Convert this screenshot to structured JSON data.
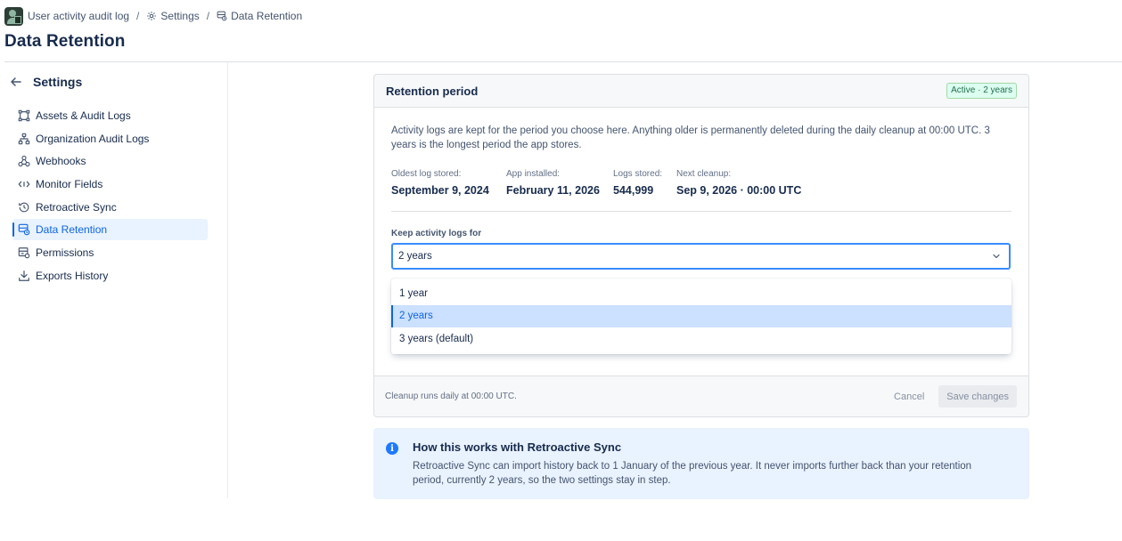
{
  "breadcrumb": {
    "app": "User activity audit log",
    "settings": "Settings",
    "current": "Data Retention"
  },
  "page_title": "Data Retention",
  "sidebar": {
    "title": "Settings",
    "items": [
      {
        "label": "Assets & Audit Logs",
        "icon": "assets-icon"
      },
      {
        "label": "Organization Audit Logs",
        "icon": "org-tree-icon"
      },
      {
        "label": "Webhooks",
        "icon": "webhook-icon"
      },
      {
        "label": "Monitor Fields",
        "icon": "code-icon"
      },
      {
        "label": "Retroactive Sync",
        "icon": "history-icon"
      },
      {
        "label": "Data Retention",
        "icon": "data-retention-icon",
        "active": true
      },
      {
        "label": "Permissions",
        "icon": "permissions-icon"
      },
      {
        "label": "Exports History",
        "icon": "download-icon"
      }
    ]
  },
  "retention": {
    "title": "Retention period",
    "badge": "Active · 2 years",
    "description": "Activity logs are kept for the period you choose here. Anything older is permanently deleted during the daily cleanup at 00:00 UTC. 3 years is the longest period the app stores.",
    "stats": [
      {
        "label": "Oldest log stored:",
        "value": "September 9, 2024"
      },
      {
        "label": "App installed:",
        "value": "February 11, 2026"
      },
      {
        "label": "Logs stored:",
        "value": "544,999"
      },
      {
        "label": "Next cleanup:",
        "value": "Sep 9, 2026 · 00:00 UTC"
      }
    ],
    "field_label": "Keep activity logs for",
    "selected": "2 years",
    "options": [
      "1 year",
      "2 years",
      "3 years (default)"
    ],
    "footer_note": "Cleanup runs daily at 00:00 UTC.",
    "cancel_label": "Cancel",
    "save_label": "Save changes"
  },
  "info": {
    "title": "How this works with Retroactive Sync",
    "text": "Retroactive Sync can import history back to 1 January of the previous year. It never imports further back than your retention period, currently 2 years, so the two settings stay in step."
  },
  "colors": {
    "accent": "#0c66e4",
    "badge_bg": "#dcfff1",
    "badge_text": "#216e4e",
    "info_bg": "#e9f2ff"
  }
}
